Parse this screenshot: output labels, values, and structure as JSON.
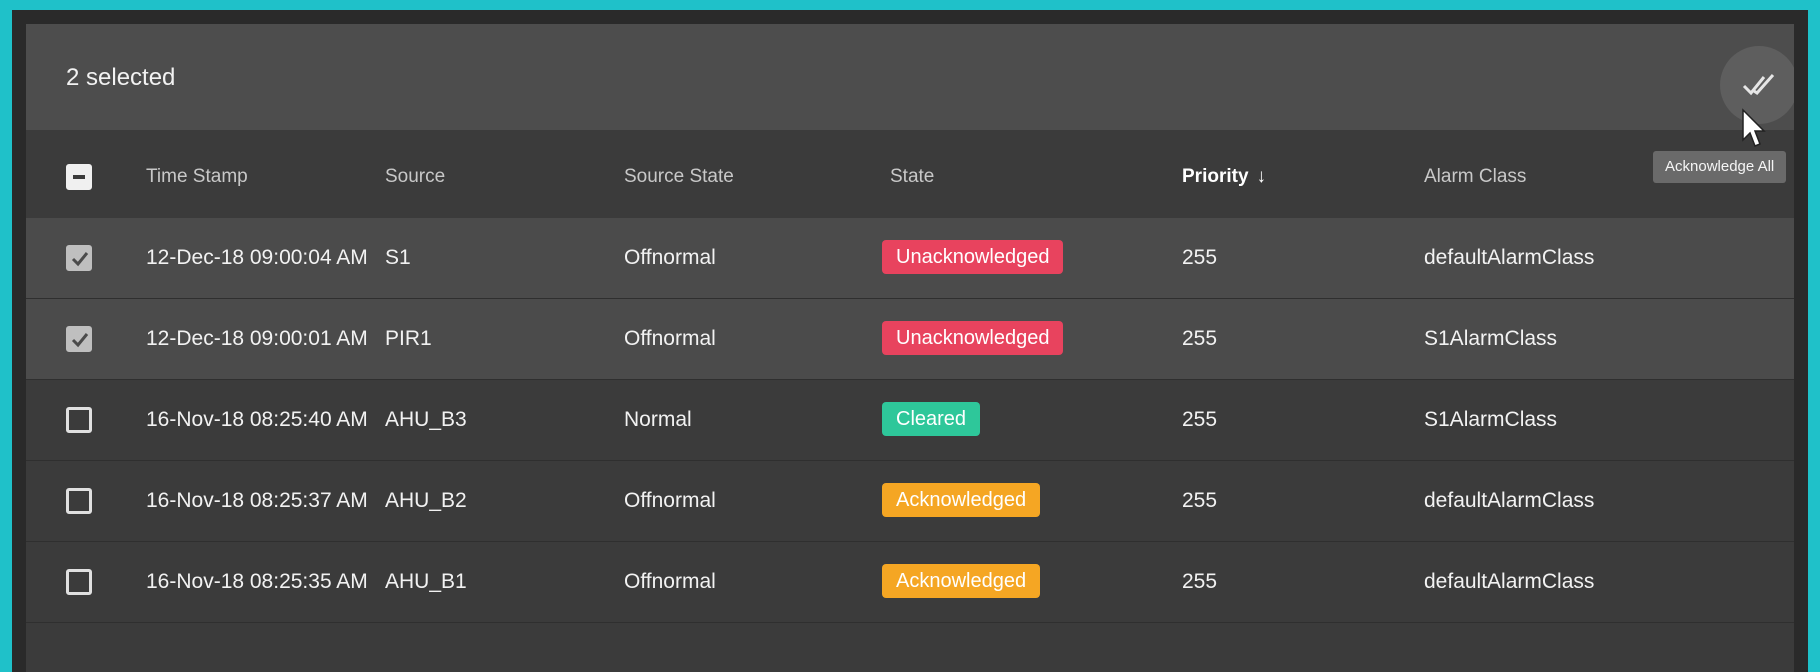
{
  "selection": {
    "count_label": "2 selected"
  },
  "toolbar": {
    "acknowledge_all_tooltip": "Acknowledge All"
  },
  "columns": {
    "time_stamp": "Time Stamp",
    "source": "Source",
    "source_state": "Source State",
    "state": "State",
    "priority": "Priority",
    "priority_sort_arrow": "↓",
    "alarm_class": "Alarm Class"
  },
  "colors": {
    "unacknowledged": "#e8435e",
    "cleared": "#2ec79a",
    "acknowledged": "#f5a623",
    "frame_accent": "#1fc1c9"
  },
  "rows": [
    {
      "checked": true,
      "time_stamp": "12-Dec-18 09:00:04 AM",
      "source": "S1",
      "source_state": "Offnormal",
      "state": "Unacknowledged",
      "priority": "255",
      "alarm_class": "defaultAlarmClass"
    },
    {
      "checked": true,
      "time_stamp": "12-Dec-18 09:00:01 AM",
      "source": "PIR1",
      "source_state": "Offnormal",
      "state": "Unacknowledged",
      "priority": "255",
      "alarm_class": "S1AlarmClass"
    },
    {
      "checked": false,
      "time_stamp": "16-Nov-18 08:25:40 AM",
      "source": "AHU_B3",
      "source_state": "Normal",
      "state": "Cleared",
      "priority": "255",
      "alarm_class": "S1AlarmClass"
    },
    {
      "checked": false,
      "time_stamp": "16-Nov-18 08:25:37 AM",
      "source": "AHU_B2",
      "source_state": "Offnormal",
      "state": "Acknowledged",
      "priority": "255",
      "alarm_class": "defaultAlarmClass"
    },
    {
      "checked": false,
      "time_stamp": "16-Nov-18 08:25:35 AM",
      "source": "AHU_B1",
      "source_state": "Offnormal",
      "state": "Acknowledged",
      "priority": "255",
      "alarm_class": "defaultAlarmClass"
    }
  ]
}
